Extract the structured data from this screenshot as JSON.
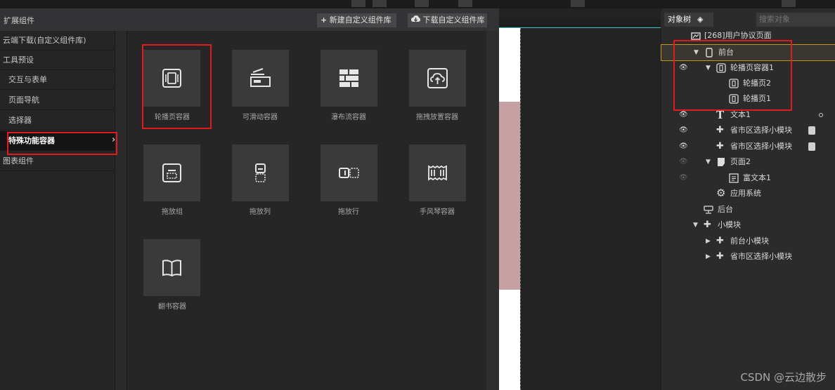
{
  "left_panel": {
    "title": "扩展组件",
    "new_library_button": "新建自定义组件库",
    "download_library_button": "下载自定义组件库",
    "categories": [
      {
        "label": "云端下载(自定义组件库)"
      },
      {
        "label": "工具预设"
      },
      {
        "label": "交互与表单"
      },
      {
        "label": "页面导航"
      },
      {
        "label": "选择器"
      },
      {
        "label": "特殊功能容器",
        "active": true
      },
      {
        "label": "图表组件"
      }
    ],
    "components": [
      {
        "label": "轮播页容器",
        "icon": "carousel-icon"
      },
      {
        "label": "可滑动容器",
        "icon": "swipe-icon"
      },
      {
        "label": "瀑布流容器",
        "icon": "brick-wall-icon"
      },
      {
        "label": "拖拽放置容器",
        "icon": "upload-cloud-icon"
      },
      {
        "label": "拖放组",
        "icon": "drag-group-icon"
      },
      {
        "label": "拖放列",
        "icon": "drag-column-icon"
      },
      {
        "label": "拖放行",
        "icon": "drag-row-icon"
      },
      {
        "label": "手风琴容器",
        "icon": "accordion-icon"
      },
      {
        "label": "翻书容器",
        "icon": "book-icon"
      }
    ]
  },
  "right_panel": {
    "tab_label": "对象树",
    "search_placeholder": "搜索对象",
    "tree": [
      {
        "label": "[268]用户协议页面",
        "icon": "page-icon"
      },
      {
        "label": "前台",
        "icon": "phone-icon",
        "expanded": true,
        "selected": true
      },
      {
        "label": "轮播页容器1",
        "icon": "carousel-icon",
        "expanded": true,
        "visible": true
      },
      {
        "label": "轮播页2",
        "icon": "carousel-icon"
      },
      {
        "label": "轮播页1",
        "icon": "carousel-icon"
      },
      {
        "label": "文本1",
        "icon": "text-icon",
        "visible": true
      },
      {
        "label": "省市区选择小模块",
        "icon": "puzzle-icon",
        "visible": true
      },
      {
        "label": "省市区选择小模块",
        "icon": "puzzle-icon",
        "visible": true
      },
      {
        "label": "页面2",
        "icon": "page-icon",
        "expanded": true,
        "visible": false
      },
      {
        "label": "富文本1",
        "icon": "richtext-icon",
        "visible": false
      },
      {
        "label": "应用系统",
        "icon": "gear-icon"
      },
      {
        "label": "后台",
        "icon": "server-icon"
      },
      {
        "label": "小模块",
        "icon": "puzzle-icon",
        "expanded": true
      },
      {
        "label": "前台小模块",
        "icon": "puzzle-icon",
        "expanded": false
      },
      {
        "label": "省市区选择小模块",
        "icon": "puzzle-icon",
        "expanded": false
      }
    ]
  },
  "watermark": "CSDN @云边散步",
  "colors": {
    "highlight": "#e01b1b",
    "selected_outline": "#c4951d",
    "canvas_accent": "#c6a1a3"
  }
}
